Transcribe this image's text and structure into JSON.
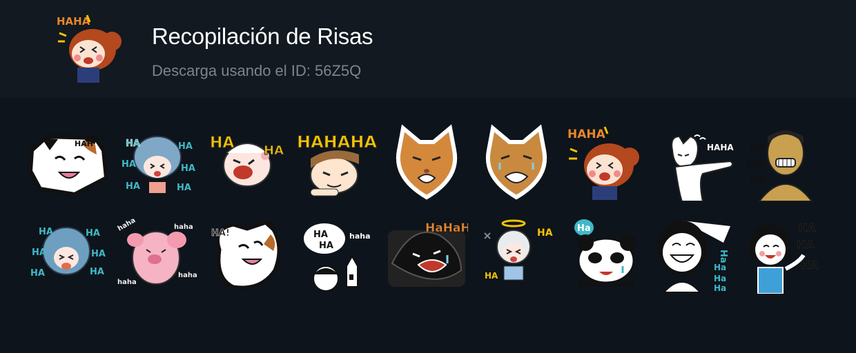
{
  "pack": {
    "title": "Recopilación de Risas",
    "subtitle": "Descarga usando el ID: 56Z5Q",
    "icon": "laughing-girl-sticker"
  },
  "stickers": {
    "row1": [
      {
        "name": "laughing-calico-cat-sticker",
        "text": "HAH"
      },
      {
        "name": "laughing-blue-hair-girl-sticker",
        "text": "HA"
      },
      {
        "name": "laughing-pink-cheek-girl-sticker",
        "text_left": "HA",
        "text_right": "HA"
      },
      {
        "name": "laughing-boy-hahaha-sticker",
        "text": "HAHAHA"
      },
      {
        "name": "laughing-orange-cat-sticker"
      },
      {
        "name": "laughing-orange-cat-tears-sticker"
      },
      {
        "name": "laughing-girl-haha-sticker",
        "text": "HAHA"
      },
      {
        "name": "pointing-white-cat-sticker",
        "text": "HAHA"
      },
      {
        "name": "laughing-man-sticker",
        "text": "HA"
      }
    ],
    "row2": [
      {
        "name": "laughing-blue-hair-girl-2-sticker",
        "text": "HA"
      },
      {
        "name": "laughing-pink-pig-sticker",
        "text": "haha"
      },
      {
        "name": "laughing-calico-cat-rolling-sticker",
        "text": "HA!"
      },
      {
        "name": "laughing-castle-speech-sticker",
        "text1": "HA",
        "text2": "HA",
        "text3": "haha"
      },
      {
        "name": "laughing-black-cat-sticker",
        "text": "HaHaHa"
      },
      {
        "name": "laughing-angel-boy-sticker",
        "text1": "HA",
        "text2": "HA"
      },
      {
        "name": "laughing-panda-sticker",
        "text": "Ha"
      },
      {
        "name": "laughing-black-hair-girl-sticker",
        "text": "Ha"
      },
      {
        "name": "laughing-girl-apron-sticker",
        "text": "HA"
      }
    ]
  },
  "colors": {
    "header_bg": "#121920",
    "body_bg": "#0e141b",
    "title": "#ffffff",
    "subtitle": "#7d848b",
    "haha_orange": "#e8862a",
    "ha_yellow": "#f5c400",
    "ha_cyan": "#3fb8c8"
  }
}
